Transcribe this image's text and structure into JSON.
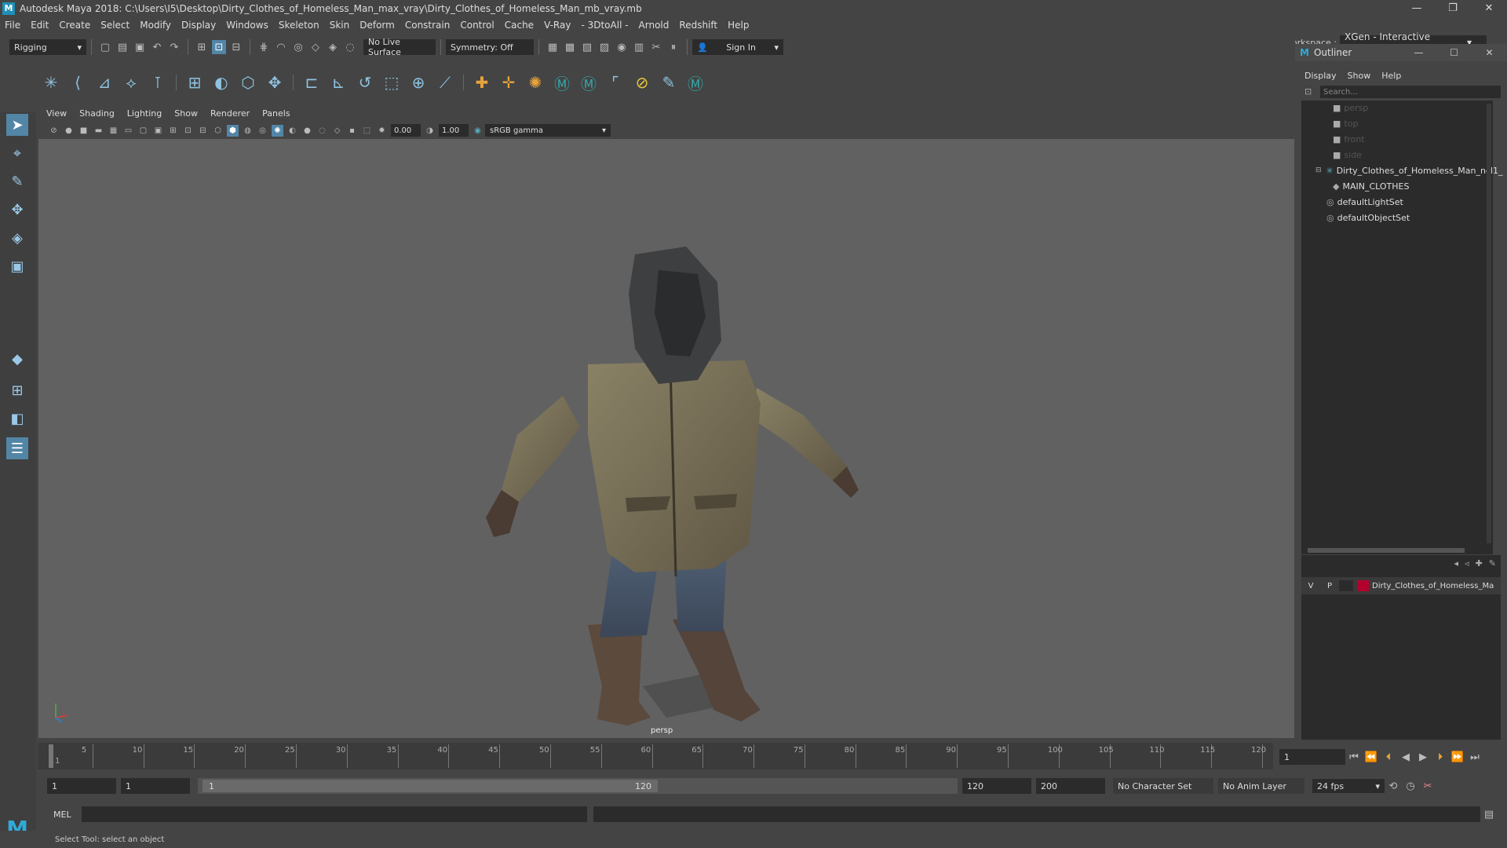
{
  "window": {
    "title": "Autodesk Maya 2018: C:\\Users\\I5\\Desktop\\Dirty_Clothes_of_Homeless_Man_max_vray\\Dirty_Clothes_of_Homeless_Man_mb_vray.mb",
    "logo": "M",
    "minimize": "—",
    "restore": "❐",
    "close": "✕"
  },
  "menubar": [
    "File",
    "Edit",
    "Create",
    "Select",
    "Modify",
    "Display",
    "Windows",
    "Skeleton",
    "Skin",
    "Deform",
    "Constrain",
    "Control",
    "Cache",
    "V-Ray",
    "- 3DtoAll -",
    "Arnold",
    "Redshift",
    "Help"
  ],
  "workspace": {
    "label": "Workspace :",
    "value": "XGen - Interactive Groom*"
  },
  "statusline": {
    "mode": "Rigging",
    "live_surface": "No Live Surface",
    "symmetry": "Symmetry: Off",
    "sign_in": "Sign In"
  },
  "viewport": {
    "menus": [
      "View",
      "Shading",
      "Lighting",
      "Show",
      "Renderer",
      "Panels"
    ],
    "exposure": "0.00",
    "gamma": "1.00",
    "colorspace": "sRGB gamma",
    "camera_label": "persp"
  },
  "outliner": {
    "title": "Outliner",
    "menus": [
      "Display",
      "Show",
      "Help"
    ],
    "search_placeholder": "Search...",
    "items": [
      {
        "label": "persp",
        "type": "camera",
        "indent": 0
      },
      {
        "label": "top",
        "type": "camera",
        "indent": 0
      },
      {
        "label": "front",
        "type": "camera",
        "indent": 0
      },
      {
        "label": "side",
        "type": "camera",
        "indent": 0
      },
      {
        "label": "Dirty_Clothes_of_Homeless_Man_ncl1_",
        "type": "group",
        "indent": 0
      },
      {
        "label": "MAIN_CLOTHES",
        "type": "mesh",
        "indent": 1
      },
      {
        "label": "defaultLightSet",
        "type": "set",
        "indent": 0
      },
      {
        "label": "defaultObjectSet",
        "type": "set",
        "indent": 0
      }
    ]
  },
  "layers": {
    "row": {
      "v": "V",
      "p": "P",
      "name": "Dirty_Clothes_of_Homeless_Ma",
      "color": "#b3002d"
    }
  },
  "timeline": {
    "ticks": [
      "5",
      "10",
      "15",
      "20",
      "25",
      "30",
      "35",
      "40",
      "45",
      "50",
      "55",
      "60",
      "65",
      "70",
      "75",
      "80",
      "85",
      "90",
      "95",
      "100",
      "105",
      "110",
      "115",
      "120"
    ],
    "current": "1",
    "current_frame_field": "1"
  },
  "range": {
    "start": "1",
    "playback_start": "1",
    "slider_start": "1",
    "slider_end": "120",
    "playback_end": "120",
    "end": "200",
    "character_set": "No Character Set",
    "anim_layer": "No Anim Layer",
    "fps": "24 fps"
  },
  "command": {
    "lang": "MEL"
  },
  "help": {
    "text": "Select Tool: select an object"
  },
  "colors": {
    "accent": "#5285a6",
    "layer": "#b3002d"
  }
}
